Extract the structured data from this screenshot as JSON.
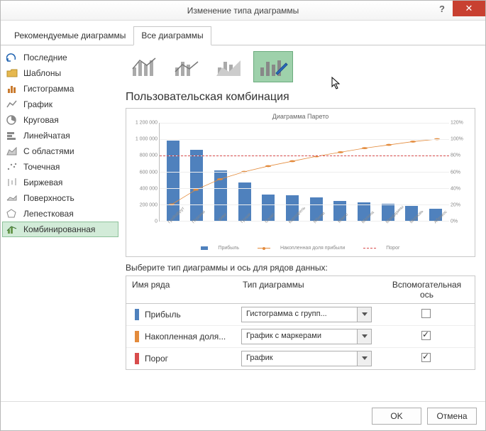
{
  "window": {
    "title": "Изменение типа диаграммы"
  },
  "tabs": {
    "recommended": "Рекомендуемые диаграммы",
    "all": "Все диаграммы"
  },
  "sidebar": {
    "items": [
      {
        "label": "Последние"
      },
      {
        "label": "Шаблоны"
      },
      {
        "label": "Гистограмма"
      },
      {
        "label": "График"
      },
      {
        "label": "Круговая"
      },
      {
        "label": "Линейчатая"
      },
      {
        "label": "С областями"
      },
      {
        "label": "Точечная"
      },
      {
        "label": "Биржевая"
      },
      {
        "label": "Поверхность"
      },
      {
        "label": "Лепестковая"
      },
      {
        "label": "Комбинированная"
      }
    ]
  },
  "subtype_title": "Пользовательская комбинация",
  "preview": {
    "title": "Диаграмма Парето",
    "legend": {
      "profit": "Прибыль",
      "cum": "Накопленная доля прибыли",
      "threshold": "Порог"
    }
  },
  "chart_data": {
    "type": "combo",
    "title": "Диаграмма Парето",
    "categories": [
      "Грейпфрут",
      "Персики",
      "Киви",
      "Груши",
      "Салат",
      "Картофель",
      "Яблоки",
      "Манго",
      "Малина",
      "Мандарины",
      "Морковь",
      "Абрикос"
    ],
    "series": [
      {
        "name": "Прибыль",
        "type": "bar",
        "axis": "primary",
        "values": [
          980000,
          870000,
          620000,
          470000,
          320000,
          310000,
          290000,
          240000,
          230000,
          210000,
          180000,
          150000
        ]
      },
      {
        "name": "Накопленная доля прибыли",
        "type": "line_markers",
        "axis": "secondary",
        "values": [
          20,
          38,
          51,
          60,
          67,
          73,
          79,
          84,
          89,
          93,
          97,
          100
        ]
      },
      {
        "name": "Порог",
        "type": "line_dashed",
        "axis": "secondary",
        "values": [
          80,
          80,
          80,
          80,
          80,
          80,
          80,
          80,
          80,
          80,
          80,
          80
        ]
      }
    ],
    "y_primary": {
      "min": 0,
      "max": 1200000,
      "step": 200000
    },
    "y_secondary": {
      "min": 0,
      "max": 120,
      "step": 20,
      "format": "percent"
    }
  },
  "series_section": {
    "label": "Выберите тип диаграммы и ось для рядов данных:",
    "headers": {
      "name": "Имя ряда",
      "type": "Тип диаграммы",
      "aux": "Вспомогательная ось"
    },
    "rows": [
      {
        "color": "#4f81bd",
        "name": "Прибыль",
        "type": "Гистограмма с групп...",
        "aux": false
      },
      {
        "color": "#e38b3c",
        "name": "Накопленная доля...",
        "type": "График с маркерами",
        "aux": true
      },
      {
        "color": "#d84c4c",
        "name": "Порог",
        "type": "График",
        "aux": true
      }
    ]
  },
  "footer": {
    "ok": "OK",
    "cancel": "Отмена"
  }
}
